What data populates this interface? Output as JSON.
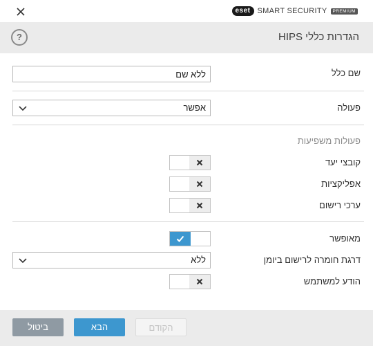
{
  "brand": {
    "logo": "eset",
    "product": "SMART SECURITY",
    "edition": "PREMIUM"
  },
  "header": {
    "title": "הגדרות כללי HIPS",
    "help": "?"
  },
  "form": {
    "rule_name_label": "שם כלל",
    "rule_name_value": "ללא שם",
    "action_label": "פעולה",
    "action_value": "אפשר",
    "affected_ops_label": "פעולות משפיעות",
    "target_files_label": "קובצי יעד",
    "target_files_on": false,
    "applications_label": "אפליקציות",
    "applications_on": false,
    "registry_label": "ערכי רישום",
    "registry_on": false,
    "enabled_label": "מאופשר",
    "enabled_on": true,
    "log_severity_label": "דרגת חומרה לרישום ביומן",
    "log_severity_value": "ללא",
    "notify_user_label": "הודע למשתמש",
    "notify_user_on": false
  },
  "footer": {
    "cancel_label": "ביטול",
    "next_label": "הבא",
    "back_label": "הקודם"
  },
  "icons": {
    "close": "close-icon",
    "chevron": "chevron-down-icon",
    "x_mark": "x-icon",
    "check": "check-icon"
  },
  "colors": {
    "accent": "#3d97cf",
    "header_bg": "#ebebeb",
    "cancel_bg": "#8f9aa3"
  }
}
